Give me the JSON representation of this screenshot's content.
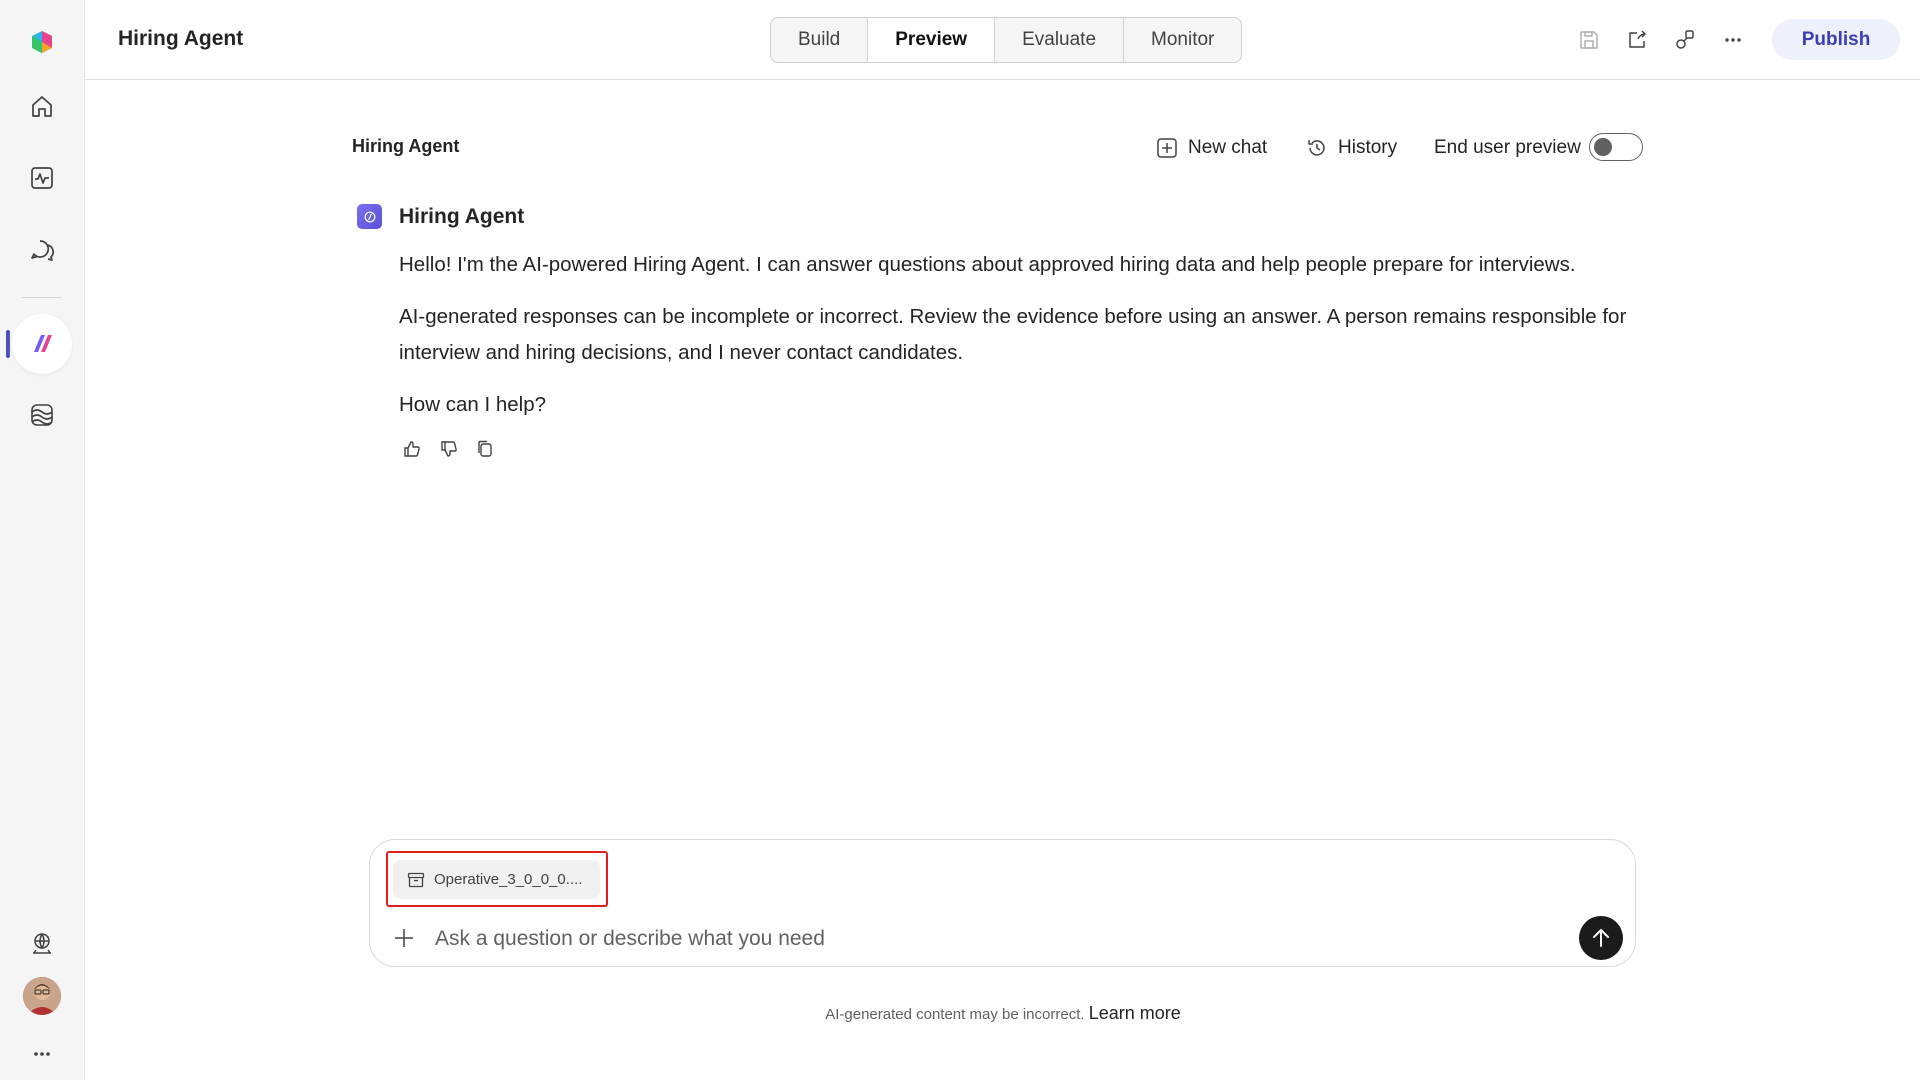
{
  "app": {
    "title": "Hiring Agent"
  },
  "rail": {
    "items": [
      {
        "name": "copilot-studio-logo-icon"
      },
      {
        "name": "home-icon"
      },
      {
        "name": "analytics-icon"
      },
      {
        "name": "chat-icon"
      },
      {
        "name": "agent-icon"
      },
      {
        "name": "library-icon"
      },
      {
        "name": "environment-globe-icon"
      },
      {
        "name": "more-icon"
      }
    ]
  },
  "header": {
    "tabs": [
      {
        "label": "Build",
        "active": false
      },
      {
        "label": "Preview",
        "active": true
      },
      {
        "label": "Evaluate",
        "active": false
      },
      {
        "label": "Monitor",
        "active": false
      }
    ],
    "publish_label": "Publish"
  },
  "chat": {
    "title": "Hiring Agent",
    "new_chat_label": "New chat",
    "history_label": "History",
    "end_user_preview_label": "End user preview",
    "end_user_preview_on": false
  },
  "message": {
    "sender": "Hiring Agent",
    "paragraphs": [
      "Hello! I'm the AI-powered Hiring Agent. I can answer questions about approved hiring data and help people prepare for interviews.",
      "AI-generated responses can be incomplete or incorrect. Review the evidence before using an answer. A person remains responsible for interview and hiring decisions, and I never contact candidates.",
      "How can I help?"
    ]
  },
  "composer": {
    "attachment_name": "Operative_3_0_0_0....",
    "placeholder": "Ask a question or describe what you need"
  },
  "footer": {
    "disclaimer": "AI-generated content may be incorrect.",
    "learn_more": "Learn more"
  },
  "colors": {
    "accent": "#4f52b2",
    "highlight": "#e02020",
    "send_button": "#1b1b1b"
  }
}
